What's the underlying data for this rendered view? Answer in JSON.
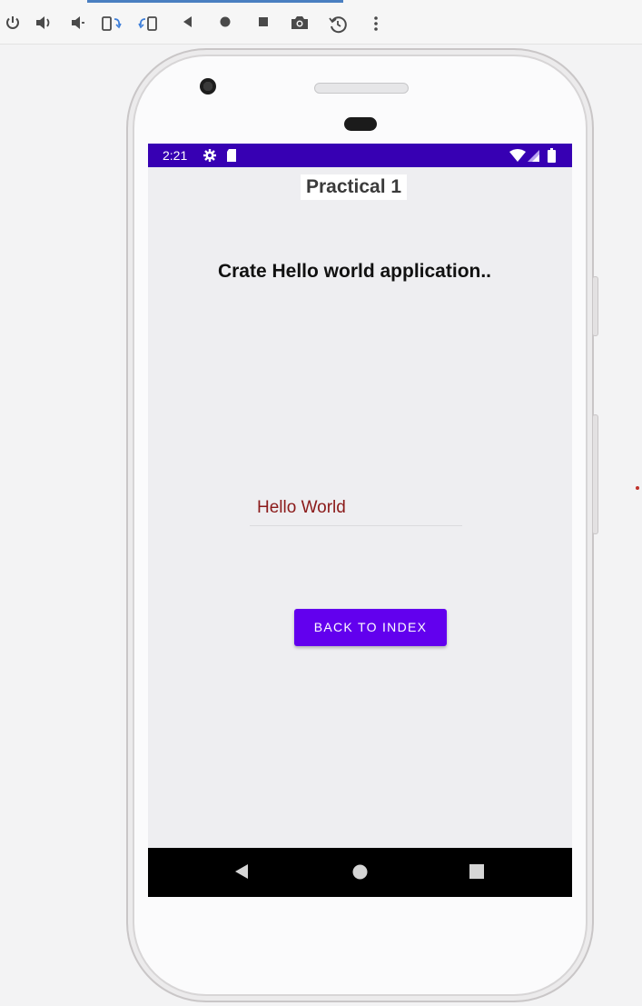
{
  "toolbar": {
    "icons": [
      "power-icon",
      "volume-up-icon",
      "volume-down-icon",
      "rotate-left-icon",
      "rotate-right-icon",
      "back-icon",
      "home-icon",
      "overview-icon",
      "screenshot-icon",
      "snapshot-icon",
      "more-icon"
    ]
  },
  "status_bar": {
    "time": "2:21",
    "icons": [
      "settings-icon",
      "sd-card-icon",
      "wifi-icon",
      "signal-icon",
      "battery-icon"
    ]
  },
  "app": {
    "title": "Practical 1",
    "heading": "Crate Hello world application..",
    "edit_text_value": "Hello World",
    "button_label": "BACK TO INDEX"
  },
  "nav_bar": {
    "icons": [
      "nav-back-icon",
      "nav-home-icon",
      "nav-recents-icon"
    ]
  },
  "colors": {
    "status_bar": "#3700b3",
    "button": "#6200ee",
    "hello_text": "#8b1a1a",
    "screen_bg": "#eeeef1"
  }
}
